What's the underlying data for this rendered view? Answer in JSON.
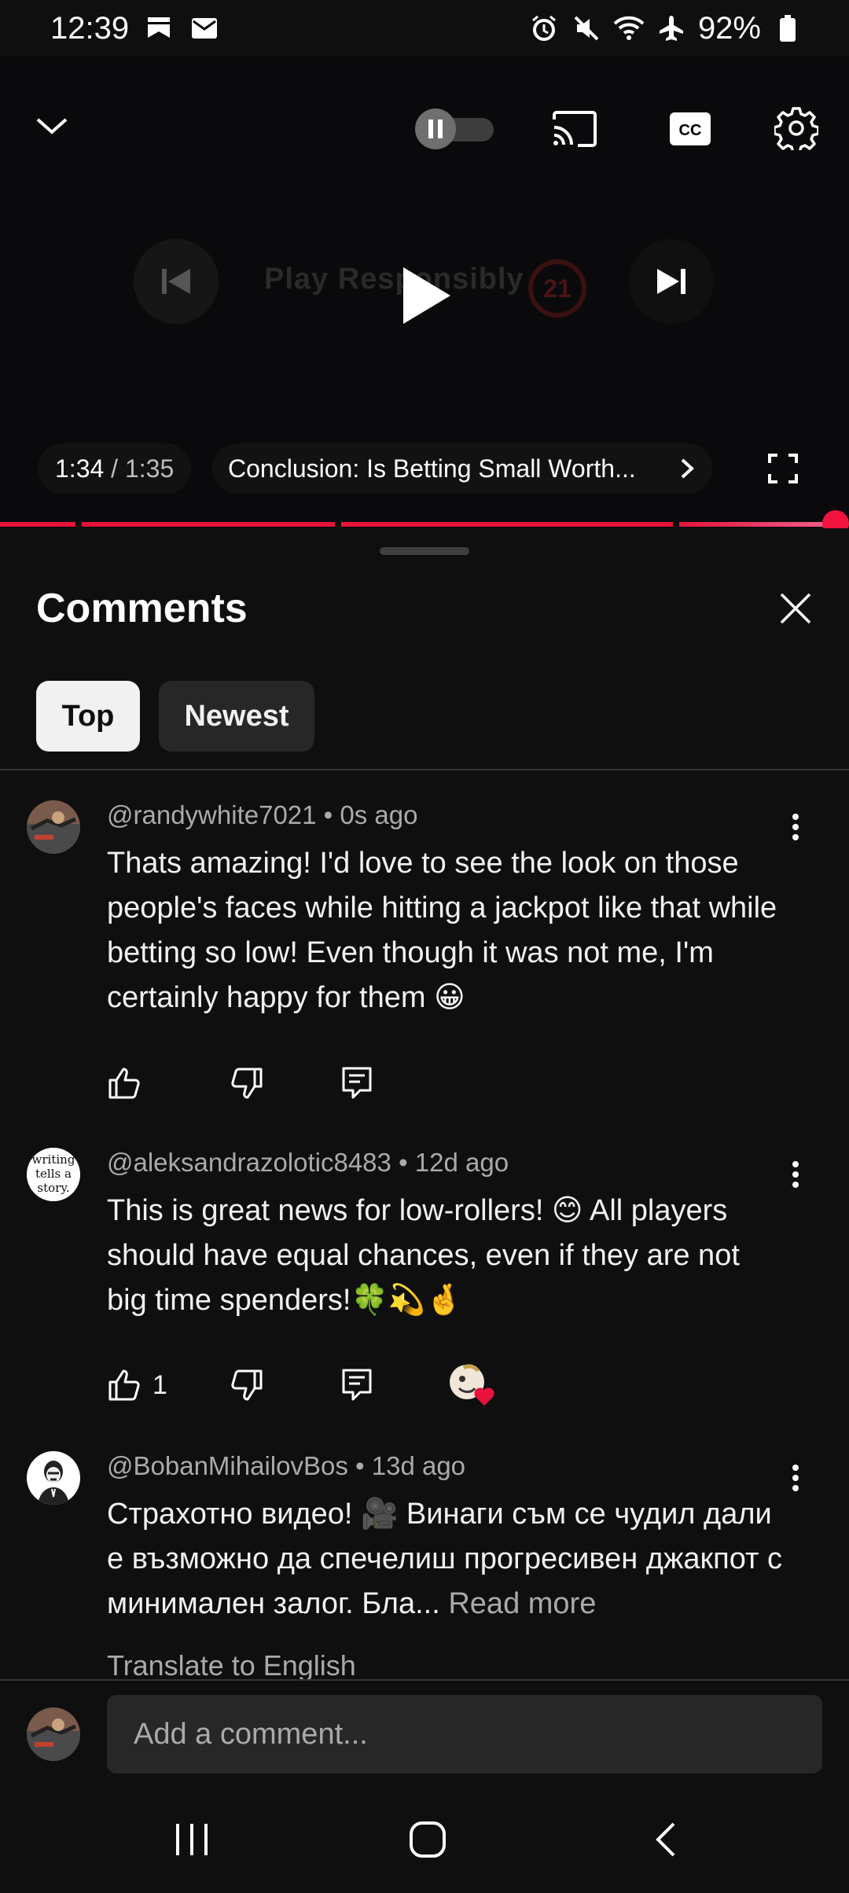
{
  "status_bar": {
    "time": "12:39",
    "battery": "92%",
    "icons": [
      "notification-icon",
      "mail-icon",
      "alarm-icon",
      "mute-icon",
      "wifi-icon",
      "airplane-icon",
      "battery-icon"
    ]
  },
  "player": {
    "watermark_text": "Play Responsibly",
    "watermark_badge": "21",
    "current_time": "1:34",
    "separator": "/",
    "duration": "1:35",
    "chapter_title": "Conclusion: Is Betting Small Worth...",
    "progress_fraction": 0.99,
    "accent_color": "#e5133a",
    "autoplay_on": false
  },
  "comments": {
    "title": "Comments",
    "sort_chips": [
      {
        "label": "Top",
        "selected": true
      },
      {
        "label": "Newest",
        "selected": false
      }
    ],
    "items": [
      {
        "author": "@randywhite7021",
        "time": "0s ago",
        "text": "Thats amazing! I'd love to see the look on those people's faces while hitting a jackpot like that while betting so low! Even though it was not me, I'm certainly happy for them 😀",
        "likes": "",
        "avatar": "avatar-photo"
      },
      {
        "author": "@aleksandrazolotic8483",
        "time": "12d ago",
        "text": "This is great news for low-rollers! 😊 All players should have equal chances,  even if they are not big time spenders!🍀💫🤞",
        "likes": "1",
        "avatar": "avatar-writing-tells-a-story",
        "avatar_text": "writing tells a story",
        "creator_hearted": true
      },
      {
        "author": "@BobanMihailovBos",
        "time": "13d ago",
        "text": "Страхотно видео! 🎥 Винаги съм се чудил дали е възможно да спечелиш прогресивен джакпот с минимален залог. Бла...",
        "read_more": "Read more",
        "translate": "Translate to English",
        "likes": "",
        "avatar": "avatar-portrait"
      }
    ],
    "meta_separator": "•"
  },
  "composer": {
    "placeholder": "Add a comment..."
  }
}
